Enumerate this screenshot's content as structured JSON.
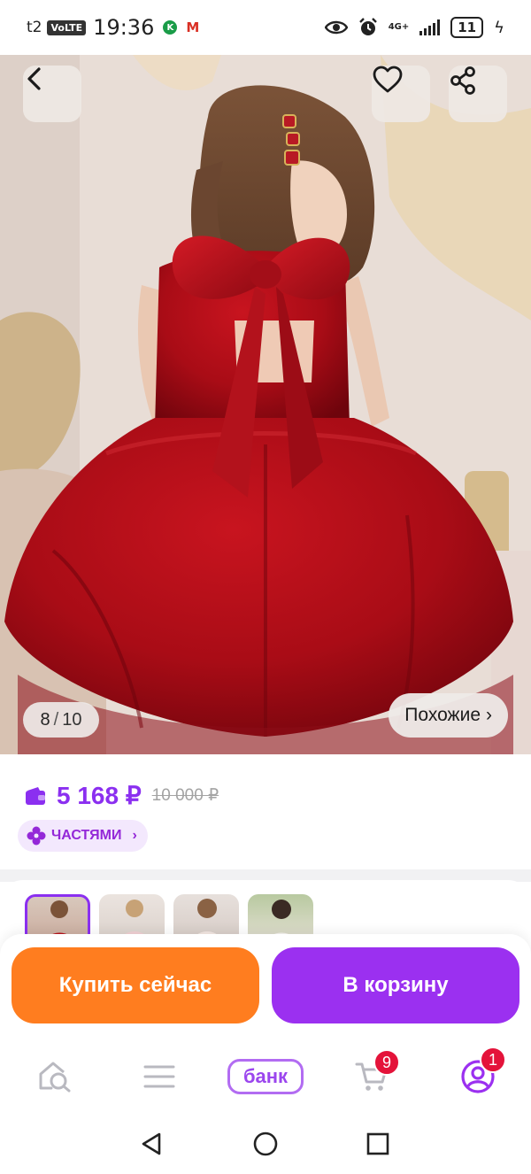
{
  "status_bar": {
    "carrier": "t2",
    "volte": "VoLTE",
    "time": "19:36",
    "kaspersky": "K",
    "gmail": "M",
    "network": "4G+",
    "battery": "11"
  },
  "gallery": {
    "current": "8",
    "separator": "/",
    "total": "10",
    "similar_label": "Похожие",
    "similar_chevron": "›"
  },
  "price": {
    "current": "5 168 ₽",
    "old": "10 000 ₽",
    "installments_label": "ЧАСТЯМИ",
    "installments_chevron": "›",
    "accent": "#8b2ff0"
  },
  "actions": {
    "buy_now": "Купить сейчас",
    "add_to_cart": "В корзину",
    "buy_color": "#ff7d1f",
    "cart_color": "#9b30f0"
  },
  "bottom_nav": {
    "bank_label": "банк",
    "cart_badge": "9",
    "profile_badge": "1"
  },
  "icons": [
    "back-arrow-icon",
    "heart-icon",
    "share-icon",
    "wallet-icon",
    "installments-icon",
    "search-home-icon",
    "catalog-menu-icon",
    "cart-icon",
    "profile-icon",
    "back-triangle-icon",
    "home-circle-icon",
    "recents-square-icon"
  ]
}
